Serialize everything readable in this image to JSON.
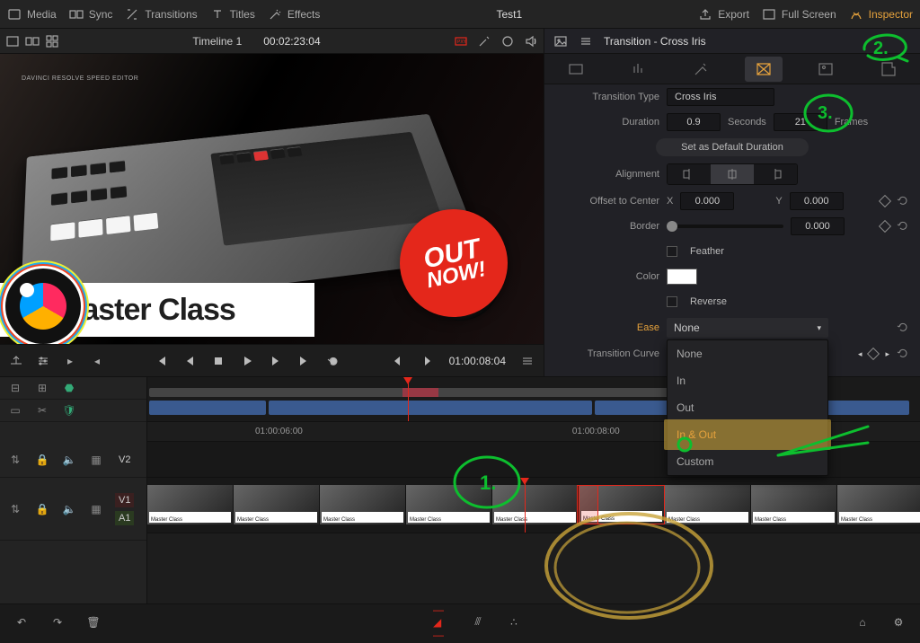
{
  "topbar": {
    "left": [
      "Media",
      "Sync",
      "Transitions",
      "Titles",
      "Effects"
    ],
    "project": "Test1",
    "right": [
      "Export",
      "Full Screen",
      "Inspector"
    ]
  },
  "viewerbar": {
    "timeline_name": "Timeline 1",
    "timecode": "00:02:23:04"
  },
  "preview": {
    "caption": "Master Class",
    "badge_l1": "OUT",
    "badge_l2": "NOW!",
    "device_label": "DAVINCI RESOLVE SPEED EDITOR"
  },
  "transport": {
    "current_tc": "01:00:08:04"
  },
  "inspector": {
    "title": "Transition - Cross Iris",
    "type_label": "Transition Type",
    "type_value": "Cross Iris",
    "duration_label": "Duration",
    "duration_sec": "0.9",
    "sec_label": "Seconds",
    "duration_frames": "21",
    "frames_label": "Frames",
    "set_default": "Set as Default Duration",
    "alignment_label": "Alignment",
    "offset_label": "Offset to Center",
    "offset_x_label": "X",
    "offset_x": "0.000",
    "offset_y_label": "Y",
    "offset_y": "0.000",
    "border_label": "Border",
    "border_val": "0.000",
    "feather_label": "Feather",
    "color_label": "Color",
    "reverse_label": "Reverse",
    "ease_label": "Ease",
    "ease_value": "None",
    "ease_options": [
      "None",
      "In",
      "Out",
      "In & Out",
      "Custom"
    ],
    "tcurve_label": "Transition Curve"
  },
  "timeline": {
    "tc_marks": [
      "01:00:06:00",
      "01:00:08:00"
    ],
    "tracks": {
      "v2": "V2",
      "v1": "V1",
      "a1": "A1"
    },
    "minithumb_label": "Master Class"
  },
  "annotations": {
    "n1": "1.",
    "n2": "2.",
    "n3": "3."
  }
}
